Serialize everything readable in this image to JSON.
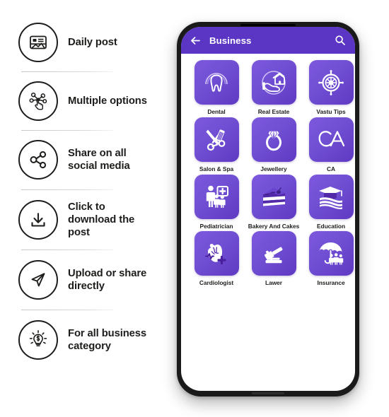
{
  "colors": {
    "app_bar": "#5b35c4",
    "tile_gradient_start": "#7c58dd",
    "tile_gradient_end": "#5f39c2",
    "text_dark": "#1d1d1b",
    "divider": "#c9c9c9",
    "phone_frame": "#1a1a1a",
    "screen_bg": "#ffffff"
  },
  "features": [
    {
      "label": "Daily post",
      "icon": "image-post-icon"
    },
    {
      "label": "Multiple options",
      "icon": "network-tap-icon"
    },
    {
      "label": "Share on all\nsocial media",
      "icon": "share-nodes-icon"
    },
    {
      "label": "Click to\ndownload the\npost",
      "icon": "download-icon"
    },
    {
      "label": "Upload or share\ndirectly",
      "icon": "send-paper-plane-icon"
    },
    {
      "label": "For all business\ncategory",
      "icon": "lightbulb-dollar-icon"
    }
  ],
  "phone": {
    "app_bar": {
      "back_icon": "arrow-left-icon",
      "title": "Business",
      "search_icon": "search-icon"
    },
    "categories": [
      {
        "label": "Dental",
        "icon": "tooth-icon"
      },
      {
        "label": "Real Estate",
        "icon": "house-in-hand-icon"
      },
      {
        "label": "Vastu Tips",
        "icon": "compass-icon"
      },
      {
        "label": "Salon & Spa",
        "icon": "scissors-comb-icon"
      },
      {
        "label": "Jewellery",
        "icon": "diamond-ring-icon"
      },
      {
        "label": "CA",
        "icon": "ca-text-icon"
      },
      {
        "label": "Pediatrician",
        "icon": "parent-child-medical-icon"
      },
      {
        "label": "Bakery And Cakes",
        "icon": "cake-slice-icon"
      },
      {
        "label": "Education",
        "icon": "graduation-cap-books-icon"
      },
      {
        "label": "Cardiologist",
        "icon": "heart-organ-icon"
      },
      {
        "label": "Lawer",
        "icon": "gavel-icon"
      },
      {
        "label": "Insurance",
        "icon": "umbrella-family-icon"
      }
    ]
  }
}
